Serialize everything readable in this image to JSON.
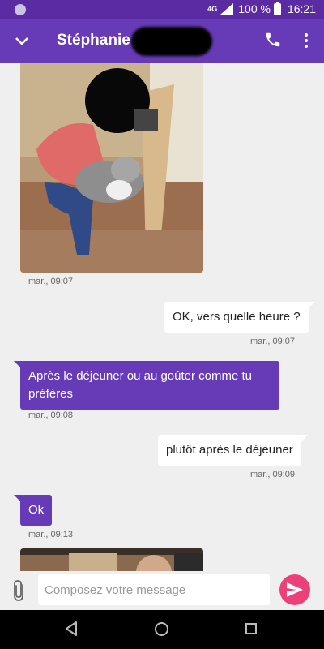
{
  "status_bar": {
    "network": "4G",
    "battery": "100 %",
    "time": "16:21"
  },
  "header": {
    "contact_name": "Stéphanie"
  },
  "messages": [
    {
      "type": "photo",
      "timestamp": "mar., 09:07"
    },
    {
      "type": "text",
      "direction": "outgoing",
      "text": "OK, vers quelle heure ?",
      "timestamp": "mar., 09:07"
    },
    {
      "type": "text",
      "direction": "incoming",
      "text": "Après le déjeuner ou au goûter comme tu préfères",
      "timestamp": "mar., 09:08"
    },
    {
      "type": "text",
      "direction": "outgoing",
      "text": "plutôt après le déjeuner",
      "timestamp": "mar., 09:09"
    },
    {
      "type": "text",
      "direction": "incoming",
      "text": "Ok",
      "timestamp": "mar., 09:13"
    },
    {
      "type": "photo"
    }
  ],
  "composer": {
    "placeholder": "Composez votre message"
  },
  "colors": {
    "primary": "#673ab7",
    "status_bar": "#5a2ba3",
    "send_button": "#ec407a",
    "background": "#efefef"
  }
}
